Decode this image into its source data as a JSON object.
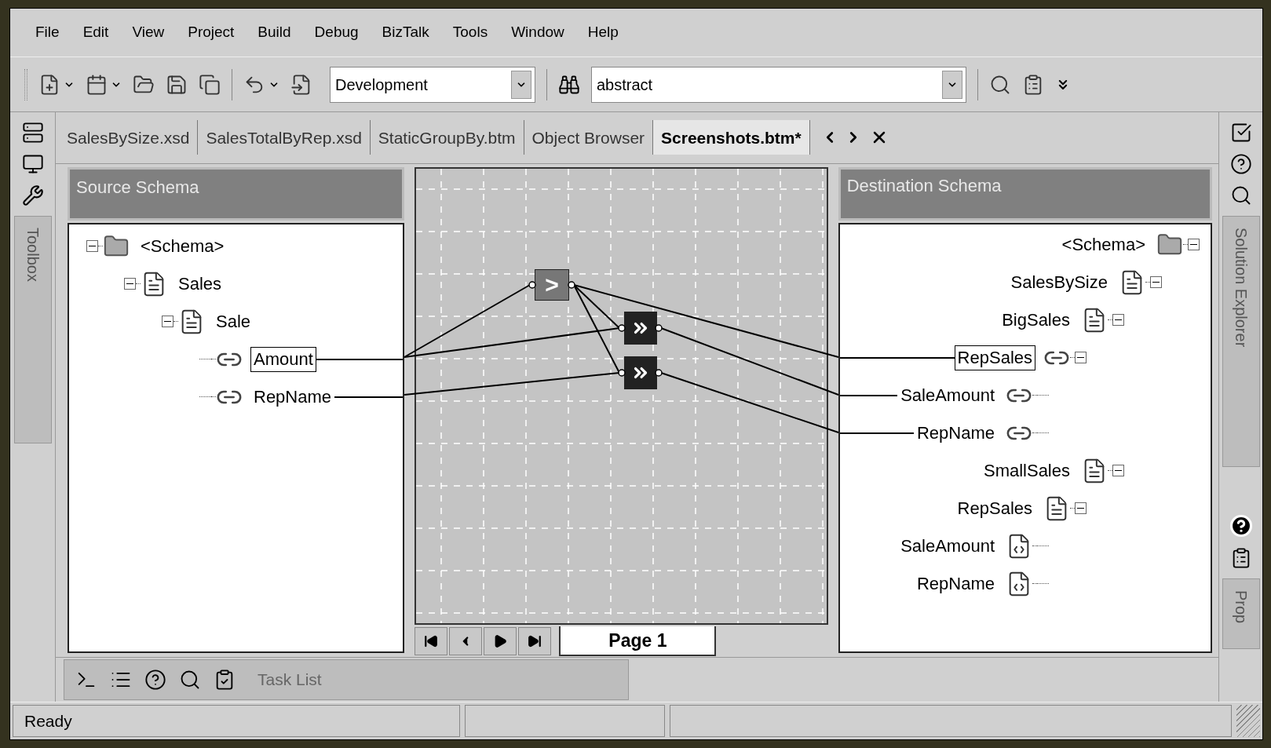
{
  "menu": [
    {
      "label": "File"
    },
    {
      "label": "Edit"
    },
    {
      "label": "View"
    },
    {
      "label": "Project"
    },
    {
      "label": "Build"
    },
    {
      "label": "Debug"
    },
    {
      "label": "BizTalk"
    },
    {
      "label": "Tools"
    },
    {
      "label": "Window"
    },
    {
      "label": "Help"
    }
  ],
  "toolbar": {
    "configuration": "Development",
    "find": "abstract"
  },
  "tabs": [
    {
      "label": "SalesBySize.xsd",
      "selected": false
    },
    {
      "label": "SalesTotalByRep.xsd",
      "selected": false
    },
    {
      "label": "StaticGroupBy.btm",
      "selected": false
    },
    {
      "label": "Object Browser",
      "selected": false
    },
    {
      "label": "Screenshots.btm*",
      "selected": true
    }
  ],
  "toolbox": {
    "label": "Toolbox"
  },
  "source_schema": {
    "title": "Source Schema",
    "tree": [
      {
        "label": "<Schema>",
        "kind": "root",
        "expanded": true,
        "selected": false,
        "mapped": false,
        "children": [
          {
            "label": "Sales",
            "kind": "record",
            "expanded": true,
            "selected": false,
            "mapped": false,
            "children": [
              {
                "label": "Sale",
                "kind": "record",
                "expanded": true,
                "selected": false,
                "mapped": false,
                "children": [
                  {
                    "label": "Amount",
                    "kind": "element",
                    "selected": true,
                    "mapped": true
                  },
                  {
                    "label": "RepName",
                    "kind": "element",
                    "selected": false,
                    "mapped": true
                  }
                ]
              }
            ]
          }
        ]
      }
    ]
  },
  "grid": {
    "functoids": [
      {
        "kind": "comparison",
        "symbol": ">"
      },
      {
        "kind": "value-mapping"
      },
      {
        "kind": "value-mapping"
      }
    ],
    "page_tab": "Page 1"
  },
  "destination_schema": {
    "title": "Destination Schema",
    "tree": [
      {
        "label": "<Schema>",
        "kind": "root",
        "expanded": true,
        "selected": false,
        "mapped": false,
        "children": [
          {
            "label": "SalesBySize",
            "kind": "record",
            "expanded": true,
            "selected": false,
            "mapped": false,
            "children": [
              {
                "label": "BigSales",
                "kind": "record",
                "expanded": true,
                "selected": false,
                "mapped": false,
                "children": [
                  {
                    "label": "RepSales",
                    "kind": "element",
                    "expanded": true,
                    "selected": true,
                    "mapped": true,
                    "children": [
                      {
                        "label": "SaleAmount",
                        "kind": "element",
                        "selected": false,
                        "mapped": true
                      },
                      {
                        "label": "RepName",
                        "kind": "element",
                        "selected": false,
                        "mapped": true
                      }
                    ]
                  }
                ]
              },
              {
                "label": "SmallSales",
                "kind": "record",
                "expanded": true,
                "selected": false,
                "mapped": false,
                "children": [
                  {
                    "label": "RepSales",
                    "kind": "record",
                    "expanded": true,
                    "selected": false,
                    "mapped": false,
                    "children": [
                      {
                        "label": "SaleAmount",
                        "kind": "attribute",
                        "selected": false,
                        "mapped": false
                      },
                      {
                        "label": "RepName",
                        "kind": "attribute",
                        "selected": false,
                        "mapped": false
                      }
                    ]
                  }
                ]
              }
            ]
          }
        ]
      }
    ]
  },
  "side_panels": {
    "solution_explorer": "Solution Explorer",
    "properties": "Prop"
  },
  "task_list": {
    "label": "Task List"
  },
  "status_bar": {
    "text": "Ready"
  }
}
